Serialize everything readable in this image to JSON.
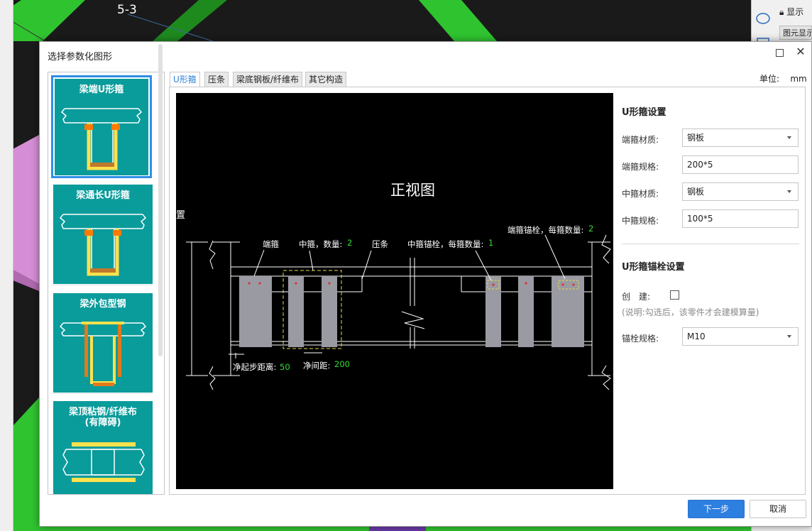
{
  "background": {
    "viewport_label": "5-3",
    "right_panel": {
      "display_label": "显示",
      "tab_label": "图元显示"
    }
  },
  "dialog": {
    "title": "选择参数化图形",
    "unit_label": "单位:",
    "unit_value": "mm",
    "tabs": [
      {
        "label": "U形箍",
        "active": true
      },
      {
        "label": "压条",
        "active": false
      },
      {
        "label": "梁底钢板/纤维布",
        "active": false
      },
      {
        "label": "其它构造",
        "active": false
      }
    ],
    "thumbnails": [
      {
        "title": "梁端U形箍",
        "selected": true
      },
      {
        "title": "梁通长U形箍",
        "selected": false
      },
      {
        "title": "梁外包型钢",
        "selected": false
      },
      {
        "title": "梁顶粘钢/纤维布\n(有障碍)",
        "selected": false
      }
    ],
    "canvas": {
      "view_title": "正视图",
      "side_label": "置",
      "annotations": {
        "end_hoop": "端箍",
        "mid_hoop": "中箍，数量:",
        "mid_hoop_count": "2",
        "press_strip": "压条",
        "mid_anchor": "中箍锚栓，每箍数量:",
        "mid_anchor_count": "1",
        "end_anchor": "端箍锚栓，每箍数量:",
        "end_anchor_count": "2",
        "start_dist": "净起步距离:",
        "start_dist_value": "50",
        "gap": "净间距:",
        "gap_value": "200"
      }
    },
    "settings": {
      "hoop_title": "U形箍设置",
      "end_material_label": "端箍材质:",
      "end_material_value": "钢板",
      "end_spec_label": "端箍规格:",
      "end_spec_value": "200*5",
      "mid_material_label": "中箍材质:",
      "mid_material_value": "钢板",
      "mid_spec_label": "中箍规格:",
      "mid_spec_value": "100*5",
      "anchor_title": "U形箍锚栓设置",
      "create_label": "创　建:",
      "create_checked": false,
      "create_note": "(说明:勾选后，该零件才会建模算量)",
      "anchor_spec_label": "锚栓规格:",
      "anchor_spec_value": "M10"
    },
    "buttons": {
      "next": "下一步",
      "cancel": "取消"
    }
  },
  "colors": {
    "accent": "#2d7fe0",
    "thumb_bg": "#0a9b9b",
    "canvas_bg": "#000000",
    "value_green": "#33dd33"
  }
}
